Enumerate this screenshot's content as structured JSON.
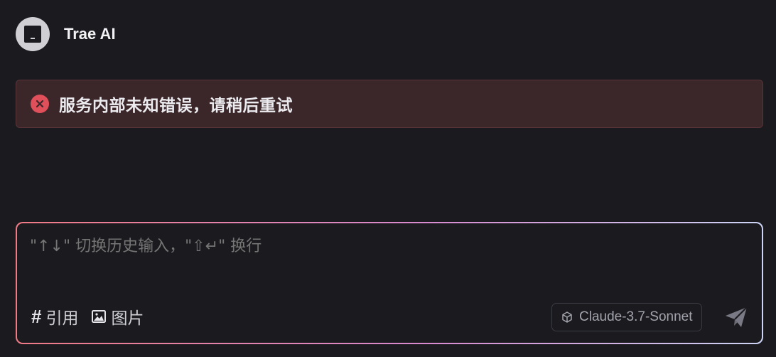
{
  "header": {
    "title": "Trae AI"
  },
  "error": {
    "message": "服务内部未知错误，请稍后重试"
  },
  "composer": {
    "placeholder": "\"↑↓\" 切换历史输入，\"⇧↵\" 换行",
    "tools": [
      {
        "icon": "hash-icon",
        "label": "引用"
      },
      {
        "icon": "image-icon",
        "label": "图片"
      }
    ],
    "model": "Claude-3.7-Sonnet"
  },
  "colors": {
    "background": "#1b1b1f",
    "error_bg": "#3b2629",
    "error_icon": "#e0505a",
    "border_gradient": [
      "#f07a86",
      "#d88ad0",
      "#cdd4f6"
    ]
  }
}
